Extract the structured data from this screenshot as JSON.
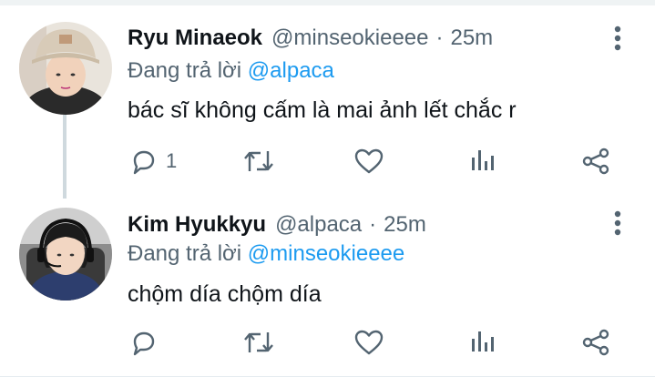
{
  "tweets": [
    {
      "name": "Ryu Minaeok",
      "handle": "@minseokieeee",
      "separator": "·",
      "time": "25m",
      "replying_prefix": "Đang trả lời",
      "replying_to": "@alpaca",
      "text": "bác sĩ không cấm là mai ảnh lết chắc r",
      "reply_count": "1"
    },
    {
      "name": "Kim Hyukkyu",
      "handle": "@alpaca",
      "separator": "·",
      "time": "25m",
      "replying_prefix": "Đang trả lời",
      "replying_to": "@minseokieeee",
      "text": "chộm día chộm día",
      "reply_count": ""
    }
  ],
  "icons": {
    "reply": "reply-icon",
    "retweet": "retweet-icon",
    "like": "heart-icon",
    "views": "analytics-icon",
    "share": "share-icon",
    "more": "more-vertical-icon"
  },
  "colors": {
    "name": "#0f1419",
    "secondary": "#536471",
    "link": "#1d9bf0",
    "thread_line": "#cfd9de"
  }
}
